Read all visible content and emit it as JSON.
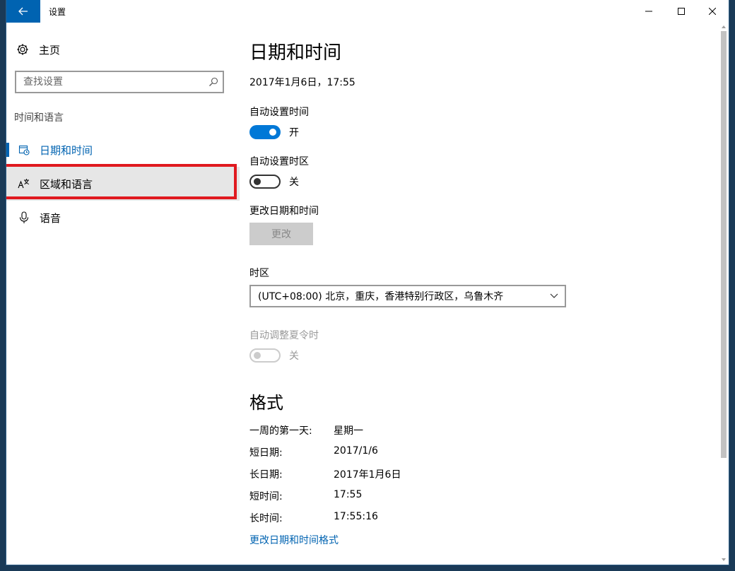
{
  "titlebar": {
    "title": "设置"
  },
  "sidebar": {
    "home_label": "主页",
    "search_placeholder": "查找设置",
    "section_label": "时间和语言",
    "items": [
      {
        "label": "日期和时间",
        "icon": "calendar-clock-icon",
        "state": "selected"
      },
      {
        "label": "区域和语言",
        "icon": "region-language-icon",
        "state": "hover"
      },
      {
        "label": "语音",
        "icon": "microphone-icon",
        "state": "normal"
      }
    ]
  },
  "main": {
    "title": "日期和时间",
    "current_datetime": "2017年1月6日，17:55",
    "auto_time": {
      "label": "自动设置时间",
      "state_text": "开",
      "on": true
    },
    "auto_timezone": {
      "label": "自动设置时区",
      "state_text": "关",
      "on": false
    },
    "change_datetime": {
      "label": "更改日期和时间",
      "button": "更改"
    },
    "timezone": {
      "label": "时区",
      "value": "(UTC+08:00) 北京，重庆，香港特别行政区，乌鲁木齐"
    },
    "dst": {
      "label": "自动调整夏令时",
      "state_text": "关",
      "on": false,
      "disabled": true
    },
    "format": {
      "title": "格式",
      "rows": [
        {
          "key": "一周的第一天:",
          "value": "星期一"
        },
        {
          "key": "短日期:",
          "value": "2017/1/6"
        },
        {
          "key": "长日期:",
          "value": "2017年1月6日"
        },
        {
          "key": "短时间:",
          "value": "17:55"
        },
        {
          "key": "长时间:",
          "value": "17:55:16"
        }
      ],
      "link": "更改日期和时间格式"
    }
  },
  "colors": {
    "accent": "#0063b1",
    "toggle_on": "#0078d7",
    "highlight": "#e0191f"
  }
}
